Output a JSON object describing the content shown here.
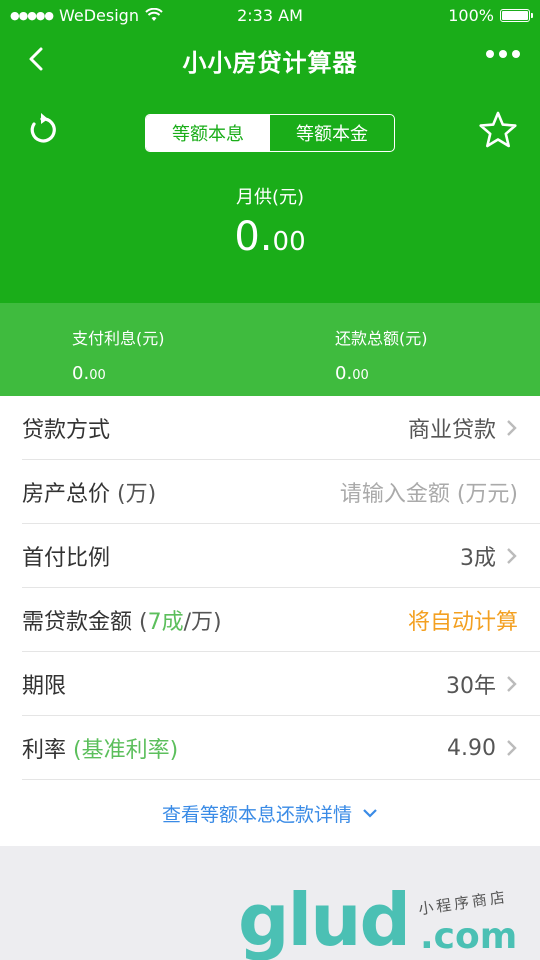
{
  "status_bar": {
    "carrier": "WeDesign",
    "time": "2:33 AM",
    "battery": "100%"
  },
  "nav": {
    "title": "小小房贷计算器"
  },
  "tabs": [
    {
      "label": "等额本息",
      "active": true
    },
    {
      "label": "等额本金",
      "active": false
    }
  ],
  "monthly": {
    "label": "月供(元)",
    "int": "0.",
    "dec": "00"
  },
  "summary": {
    "interest": {
      "label": "支付利息(元)",
      "int": "0.",
      "dec": "00"
    },
    "total": {
      "label": "还款总额(元)",
      "int": "0.",
      "dec": "00"
    }
  },
  "rows": {
    "loan_type": {
      "label": "贷款方式",
      "value": "商业贷款"
    },
    "price": {
      "label": "房产总价",
      "unit": " (万)",
      "placeholder": "请输入金额 (万元)"
    },
    "down": {
      "label": "首付比例",
      "value": "3成"
    },
    "need": {
      "label": "需贷款金额",
      "paren_open": " (",
      "ratio": "7成",
      "unit": "/万)",
      "value": "将自动计算"
    },
    "term": {
      "label": "期限",
      "value": "30年"
    },
    "rate": {
      "label": "利率",
      "note": " (基准利率)",
      "value": "4.90"
    }
  },
  "detail_link": "查看等额本息还款详情",
  "watermark": {
    "logo": "glud",
    "domain": ".com",
    "tagline": "小程序商店"
  },
  "colors": {
    "brand_green": "#1aad19",
    "sub_green": "#3fbb3e",
    "link_blue": "#3a8be6",
    "orange": "#f3a021"
  }
}
